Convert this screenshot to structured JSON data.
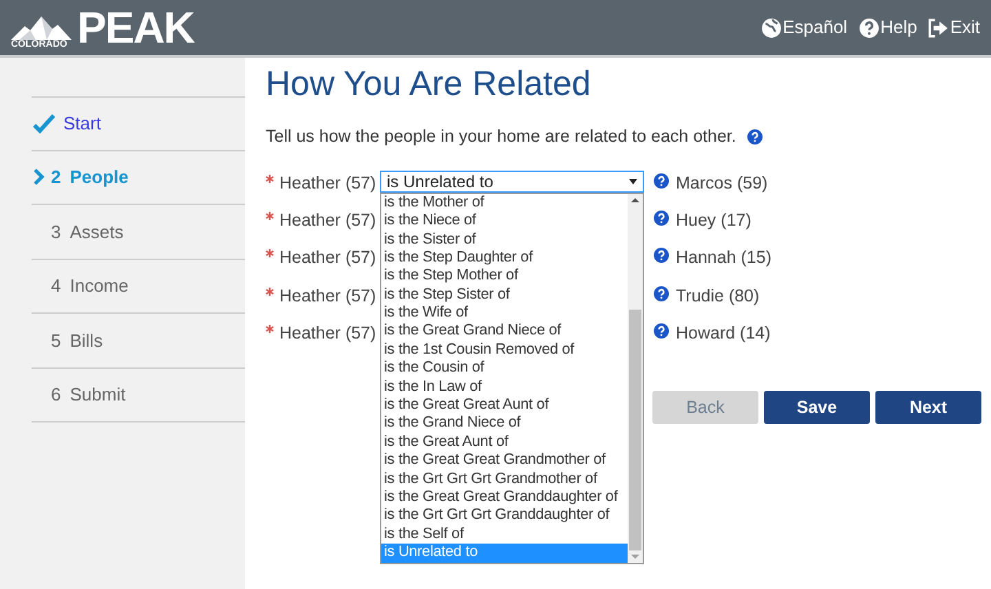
{
  "header": {
    "logo": {
      "small": "COLORADO",
      "large": "PEAK"
    },
    "links": [
      {
        "label": "Español",
        "kind": "language"
      },
      {
        "label": "Help",
        "kind": "help"
      },
      {
        "label": "Exit",
        "kind": "exit"
      }
    ]
  },
  "steps": [
    {
      "label": "Start",
      "completed": true,
      "selected": false
    },
    {
      "number": "2",
      "label": "People",
      "completed": false,
      "selected": true
    },
    {
      "number": "3",
      "label": "Assets",
      "completed": false,
      "selected": false
    },
    {
      "number": "4",
      "label": "Income",
      "completed": false,
      "selected": false
    },
    {
      "number": "5",
      "label": "Bills",
      "completed": false,
      "selected": false
    },
    {
      "number": "6",
      "label": "Submit",
      "completed": false,
      "selected": false
    }
  ],
  "page": {
    "title": "How You Are Related",
    "intro": "Tell us how the people in your home are related to each other."
  },
  "relations": [
    {
      "person": "Heather (57)",
      "required": true,
      "relation": "is Unrelated to",
      "related_to": "Marcos (59)"
    },
    {
      "person": "Heather (57)",
      "required": true,
      "related_to": "Huey (17)"
    },
    {
      "person": "Heather (57)",
      "required": true,
      "related_to": "Hannah (15)"
    },
    {
      "person": "Heather (57)",
      "required": true,
      "related_to": "Trudie (80)"
    },
    {
      "person": "Heather (57)",
      "required": true,
      "related_to": "Howard (14)"
    }
  ],
  "dropdown": {
    "options": [
      {
        "label": "is the Mother of",
        "selected": false
      },
      {
        "label": "is the Niece of",
        "selected": false
      },
      {
        "label": "is the Sister of",
        "selected": false
      },
      {
        "label": "is the Step Daughter of",
        "selected": false
      },
      {
        "label": "is the Step Mother of",
        "selected": false
      },
      {
        "label": "is the Step Sister of",
        "selected": false
      },
      {
        "label": "is the Wife of",
        "selected": false
      },
      {
        "label": "is the Great Grand Niece of",
        "selected": false
      },
      {
        "label": "is the 1st Cousin Removed of",
        "selected": false
      },
      {
        "label": "is the Cousin of",
        "selected": false
      },
      {
        "label": "is the In Law of",
        "selected": false
      },
      {
        "label": "is the Great Great Aunt of",
        "selected": false
      },
      {
        "label": "is the Grand Niece of",
        "selected": false
      },
      {
        "label": "is the Great Aunt of",
        "selected": false
      },
      {
        "label": "is the Great Great Grandmother of",
        "selected": false
      },
      {
        "label": "is the Grt Grt Grt Grandmother of",
        "selected": false
      },
      {
        "label": "is the Great Great Granddaughter of",
        "selected": false
      },
      {
        "label": "is the Grt Grt Grt Granddaughter of",
        "selected": false
      },
      {
        "label": "is the Self of",
        "selected": false
      },
      {
        "label": "is Unrelated to",
        "selected": true
      }
    ]
  },
  "buttons": [
    {
      "label": "Back",
      "kind": "secondary"
    },
    {
      "label": "Save",
      "kind": "primary"
    },
    {
      "label": "Next",
      "kind": "primary"
    }
  ]
}
